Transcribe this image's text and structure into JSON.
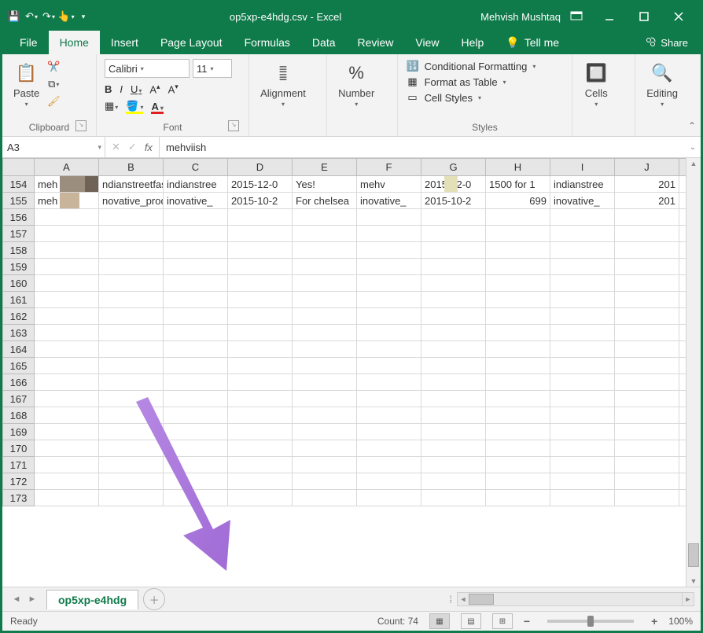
{
  "title": "op5xp-e4hdg.csv - Excel",
  "user": "Mehvish Mushtaq",
  "tabs": [
    "File",
    "Home",
    "Insert",
    "Page Layout",
    "Formulas",
    "Data",
    "Review",
    "View",
    "Help"
  ],
  "tellme": "Tell me",
  "share": "Share",
  "ribbon": {
    "clipboard": {
      "paste": "Paste",
      "label": "Clipboard"
    },
    "font": {
      "name": "Calibri",
      "size": "11",
      "label": "Font"
    },
    "alignment": {
      "btn": "Alignment",
      "label": "Alignment"
    },
    "number": {
      "btn": "Number",
      "label": "Number"
    },
    "styles": {
      "cond": "Conditional Formatting",
      "table": "Format as Table",
      "cell": "Cell Styles",
      "label": "Styles"
    },
    "cells": {
      "btn": "Cells"
    },
    "editing": {
      "btn": "Editing"
    }
  },
  "namebox": "A3",
  "formula": "mehviish",
  "columns": [
    "A",
    "B",
    "C",
    "D",
    "E",
    "F",
    "G",
    "H",
    "I",
    "J",
    ""
  ],
  "rowStart": 154,
  "rowCount": 20,
  "rows": [
    {
      "n": 154,
      "c": [
        "meh",
        "ndianstreetfashion",
        "indianstree",
        "2015-12-0",
        "Yes!",
        "mehv",
        "2015-12-0",
        "1500 for 1",
        "indianstree",
        "201"
      ]
    },
    {
      "n": 155,
      "c": [
        "meh",
        "novative_products_n",
        "inovative_",
        "2015-10-2",
        "For chelsea",
        "inovative_",
        "2015-10-2",
        "699",
        "inovative_",
        "201"
      ]
    }
  ],
  "sheet": "op5xp-e4hdg",
  "status": {
    "ready": "Ready",
    "count": "Count: 74",
    "zoom": "100%"
  }
}
